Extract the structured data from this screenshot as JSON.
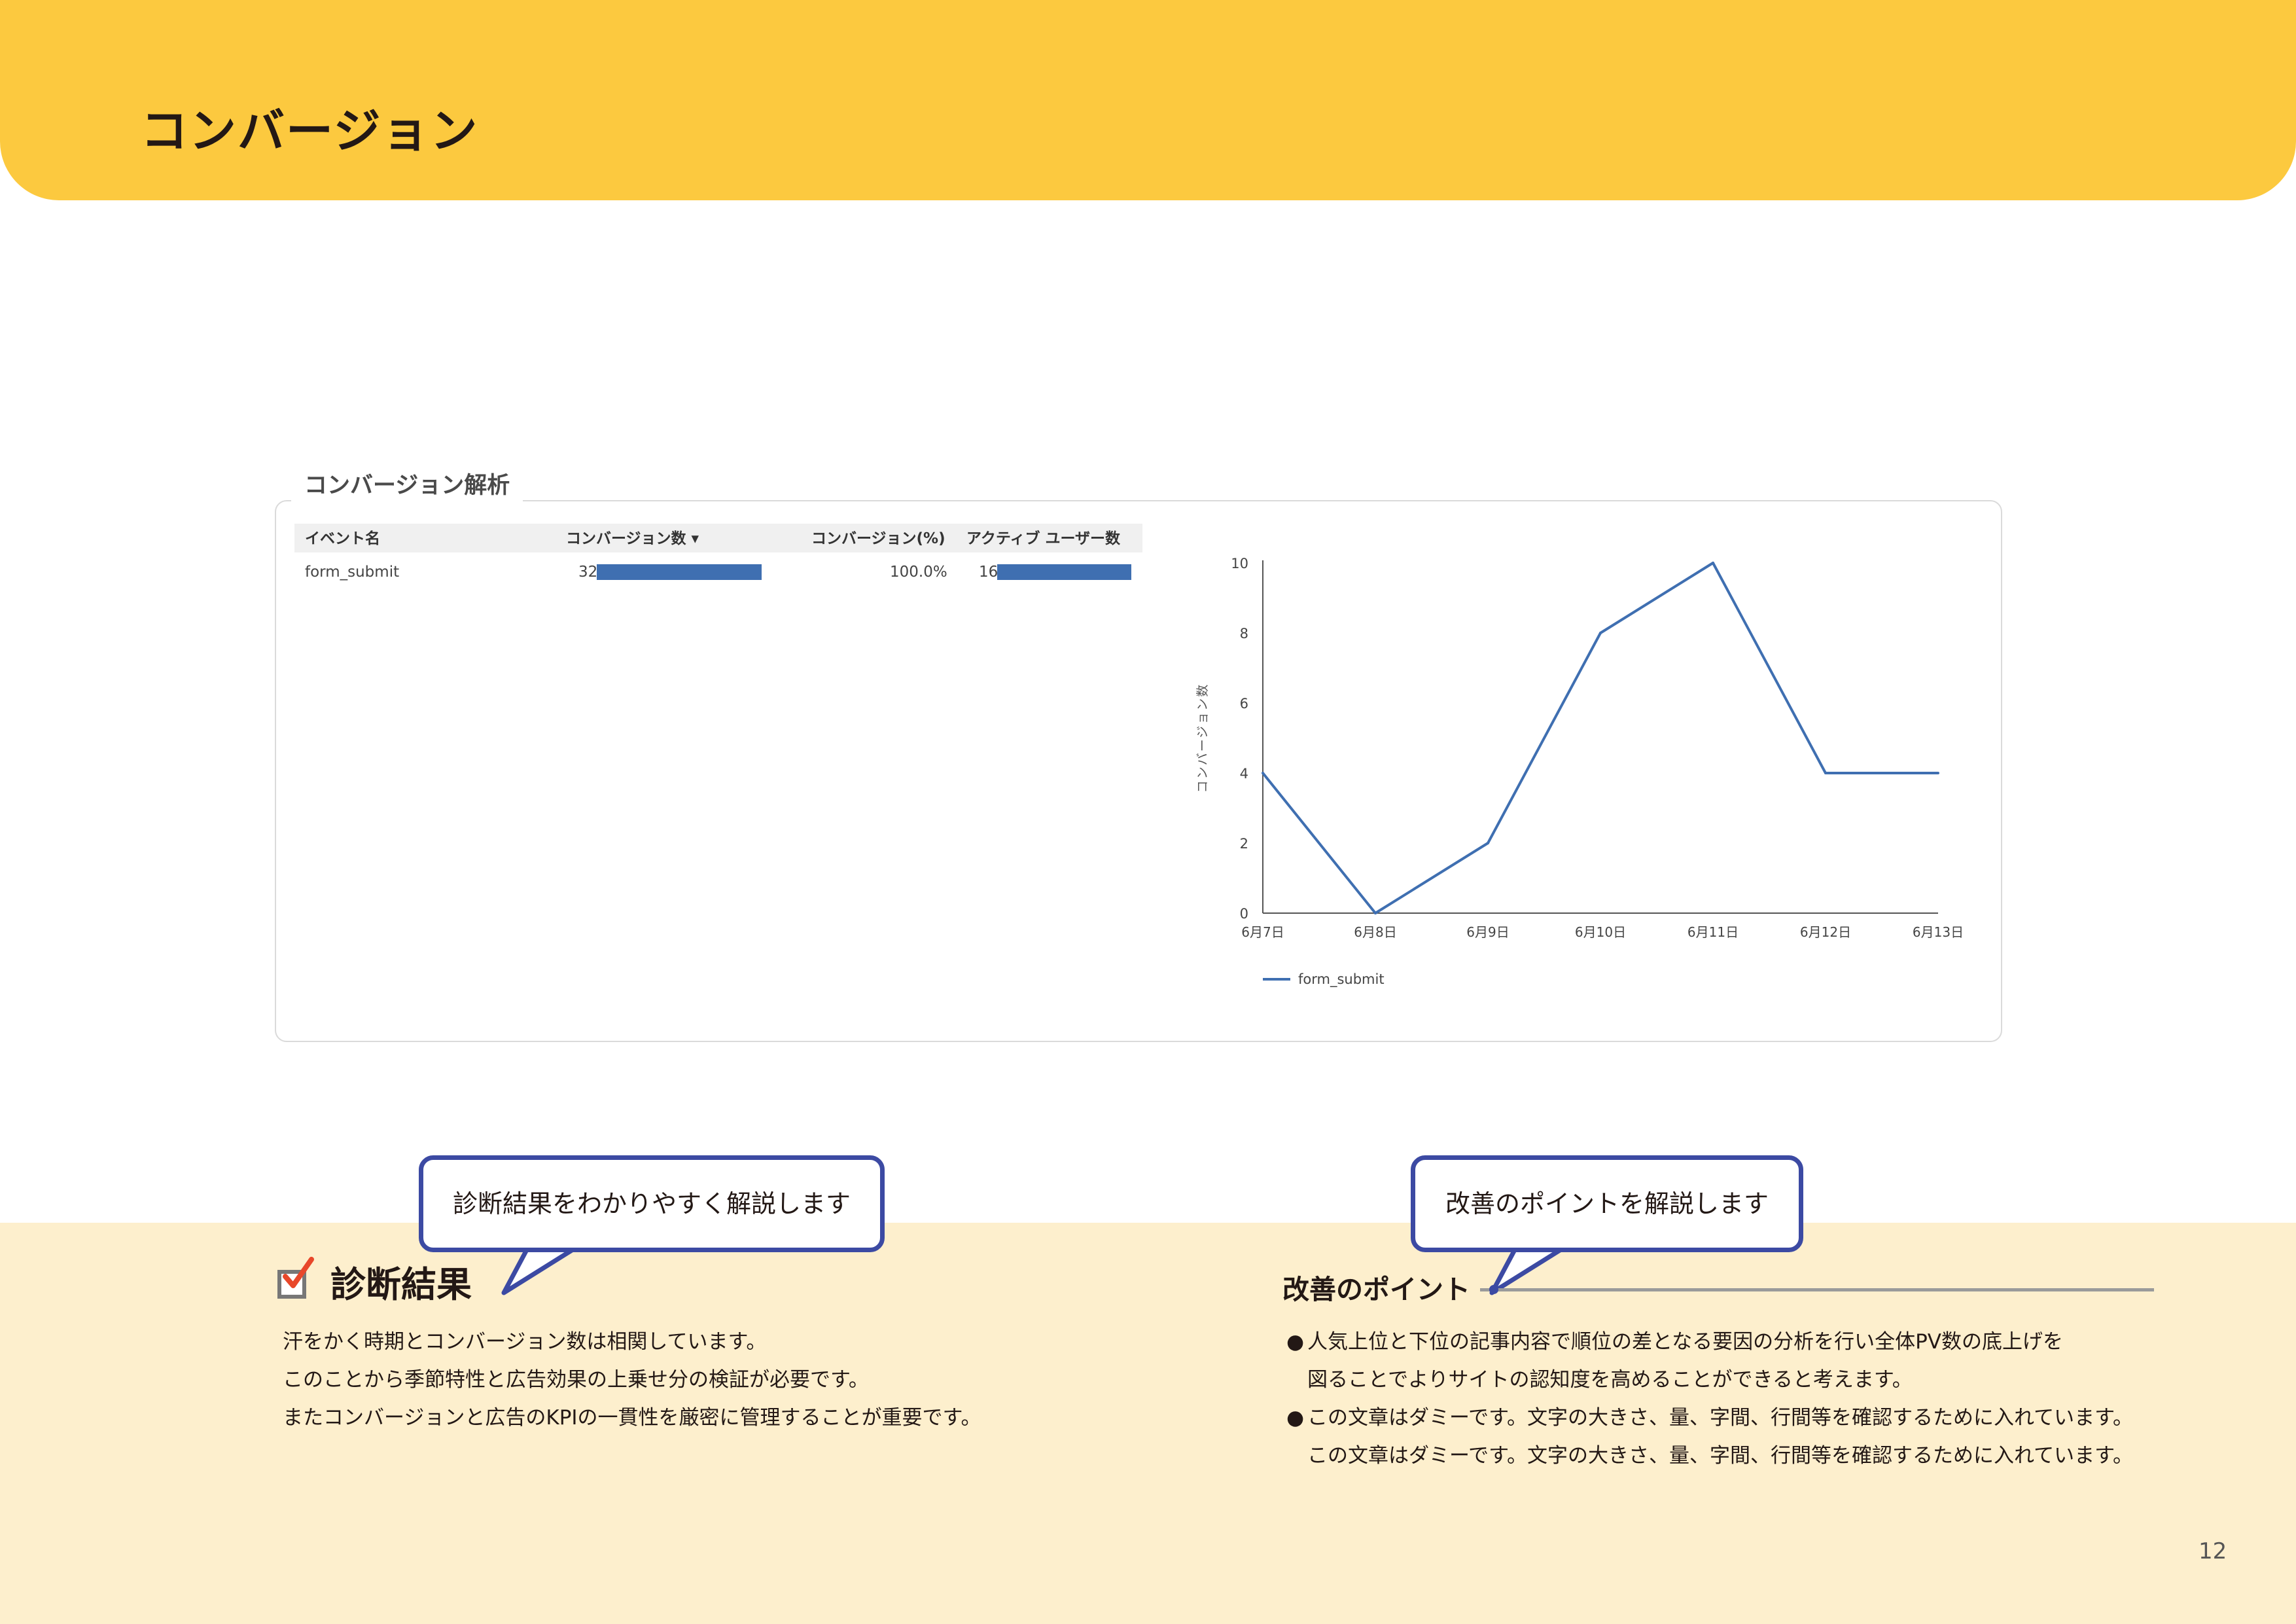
{
  "header": {
    "title": "コンバージョン"
  },
  "panel": {
    "title": "コンバージョン解析",
    "table": {
      "columns": [
        "イベント名",
        "コンバージョン数 ▾",
        "コンバージョン(%)",
        "アクティブ ユーザー数"
      ],
      "rows": [
        {
          "event": "form_submit",
          "conversions": "32",
          "conversion_pct": "100.0%",
          "active_users": "16",
          "conversions_bar": 1.0,
          "active_users_bar": 1.0
        }
      ]
    }
  },
  "chart_data": {
    "type": "line",
    "categories": [
      "6月7日",
      "6月8日",
      "6月9日",
      "6月10日",
      "6月11日",
      "6月12日",
      "6月13日"
    ],
    "series": [
      {
        "name": "form_submit",
        "values": [
          4,
          0,
          2,
          8,
          10,
          4,
          4
        ]
      }
    ],
    "ylabel": "コンバージョン数",
    "xlabel": "",
    "ylim": [
      0,
      10
    ],
    "yticks": [
      "0",
      "2",
      "4",
      "6",
      "8",
      "10"
    ],
    "grid": false,
    "legend_position": "bottom-left",
    "colors": {
      "series": "#3f6fb1",
      "axis": "#555555"
    }
  },
  "diagnosis": {
    "bubble": "診断結果をわかりやすく解説します",
    "title": "診断結果",
    "lines": [
      "汗をかく時期とコンバージョン数は相関しています。",
      "このことから季節特性と広告効果の上乗せ分の検証が必要です。",
      "またコンバージョンと広告のKPIの一貫性を厳密に管理することが重要です。"
    ]
  },
  "improvement": {
    "bubble": "改善のポイントを解説します",
    "title": "改善のポイント",
    "bullet": "●",
    "lines": [
      "人気上位と下位の記事内容で順位の差となる要因の分析を行い全体PV数の底上げを",
      "図ることでよりサイトの認知度を高めることができると考えます。",
      "この文章はダミーです。文字の大きさ、量、字間、行間等を確認するために入れています。",
      "この文章はダミーです。文字の大きさ、量、字間、行間等を確認するために入れています。"
    ]
  },
  "page_number": "12",
  "colors": {
    "header": "#fcc93f",
    "band": "#fdefcd",
    "bubble_border": "#3c4aa3",
    "check": "#e8472a"
  }
}
